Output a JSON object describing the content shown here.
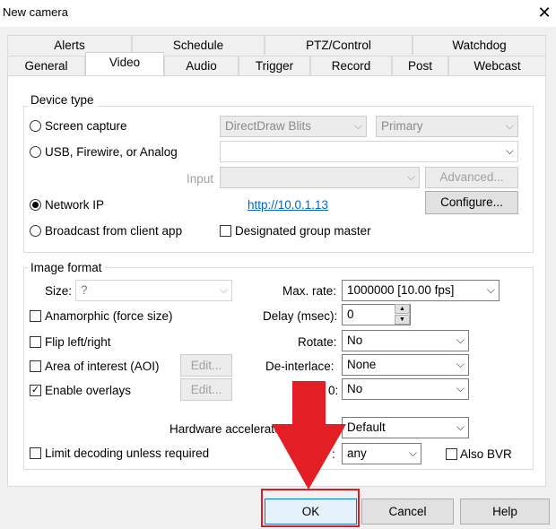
{
  "window": {
    "title": "New camera",
    "close_icon": "✕"
  },
  "tabs_row1": [
    "Alerts",
    "Schedule",
    "PTZ/Control",
    "Watchdog"
  ],
  "tabs_row2": [
    "General",
    "Video",
    "Audio",
    "Trigger",
    "Record",
    "Post",
    "Webcast"
  ],
  "active_tab": "Video",
  "device_type": {
    "group_label": "Device type",
    "screen_capture": {
      "label": "Screen capture",
      "combo1": "DirectDraw Blits",
      "combo2": "Primary"
    },
    "usb": {
      "label": "USB, Firewire, or Analog",
      "value": ""
    },
    "input_label": "Input",
    "advanced_button": "Advanced...",
    "network_ip": {
      "label": "Network IP",
      "url": "http://10.0.1.13",
      "selected": true
    },
    "configure_button": "Configure...",
    "broadcast": {
      "label": "Broadcast from client app"
    },
    "designated_master": "Designated group master"
  },
  "image_format": {
    "group_label": "Image format",
    "size_label": "Size:",
    "size_value": "?",
    "anamorphic": "Anamorphic (force size)",
    "flip": "Flip left/right",
    "aoi": "Area of interest (AOI)",
    "enable_overlays": "Enable overlays",
    "edit1": "Edit...",
    "edit2": "Edit...",
    "max_rate_label": "Max. rate:",
    "max_rate_value": "1000000 [10.00 fps]",
    "delay_label": "Delay (msec):",
    "delay_value": "0",
    "rotate_label": "Rotate:",
    "rotate_value": "No",
    "deinterlace_label": "De-interlace:",
    "deinterlace_value": "None",
    "partial_label": "0:",
    "partial_value": "No",
    "hw_label": "Hardware accelerated",
    "hw_label_suffix": "e:",
    "hw_value": "Default",
    "limit_decoding": "Limit decoding unless required",
    "any_label_suffix": ":",
    "any_value": "any",
    "also_bvr": "Also BVR"
  },
  "buttons": {
    "ok": "OK",
    "cancel": "Cancel",
    "help": "Help"
  },
  "colors": {
    "arrow": "#e31e24",
    "highlight": "#d81e24",
    "link": "#0066cc"
  }
}
